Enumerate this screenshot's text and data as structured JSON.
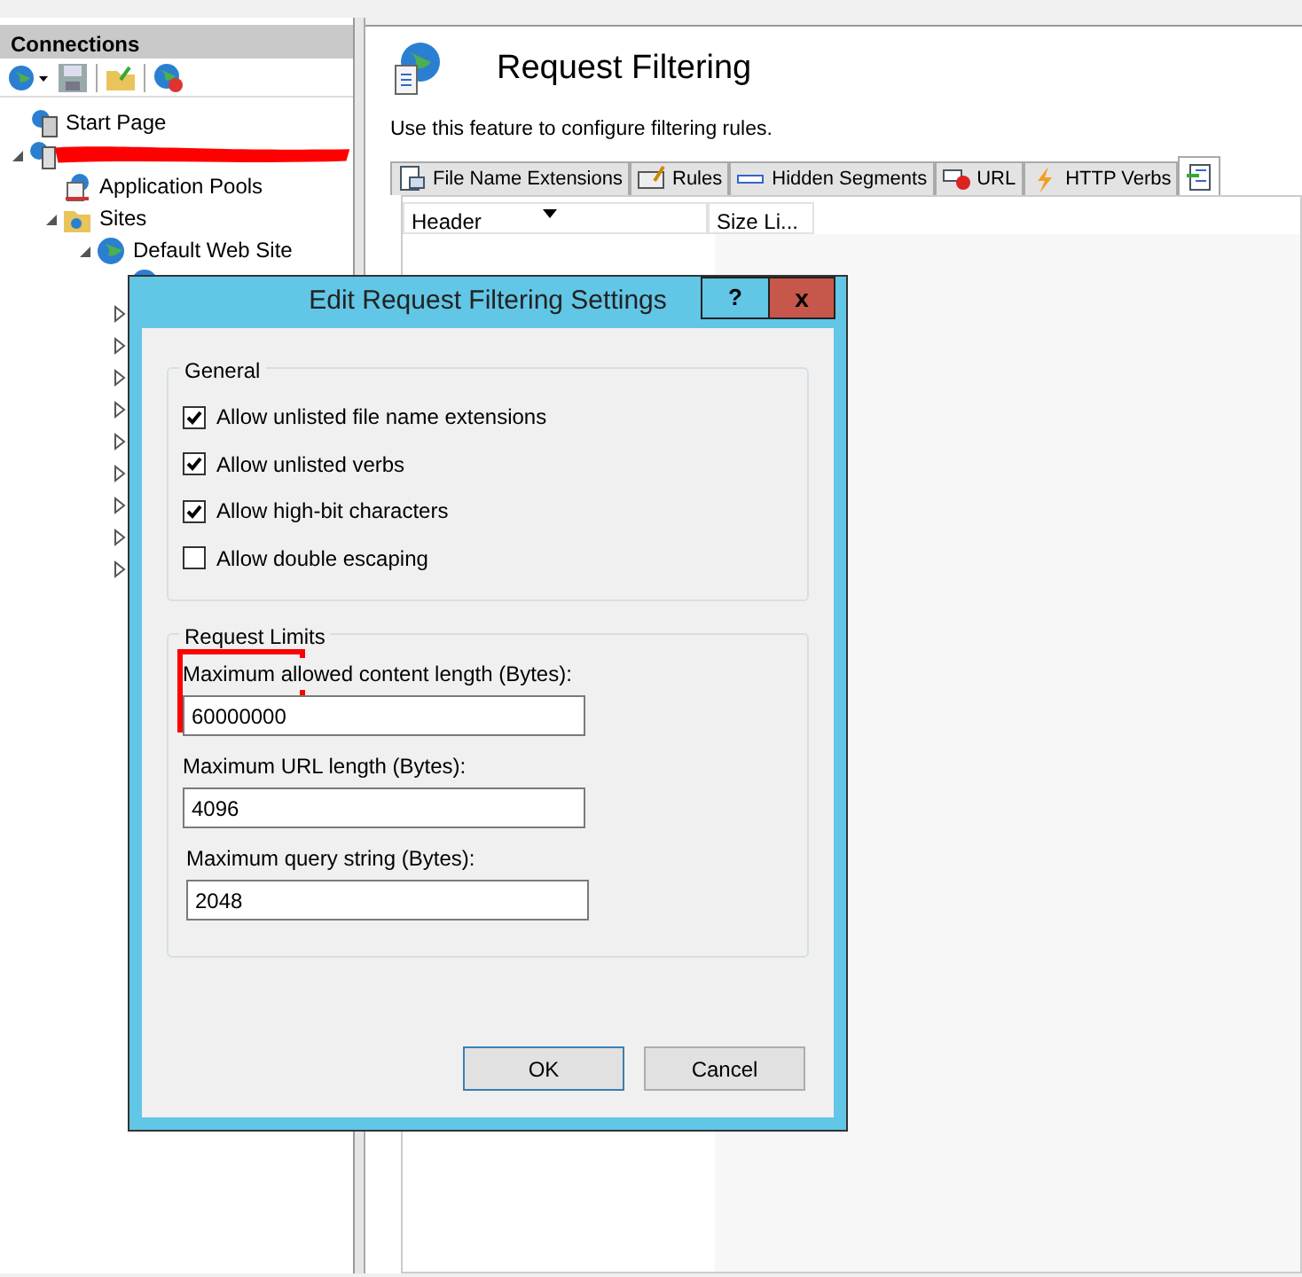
{
  "connections": {
    "title": "Connections",
    "tree": [
      {
        "kind": "page",
        "label": "Start Page"
      },
      {
        "kind": "server",
        "redacted": true,
        "expanded": true,
        "children": [
          {
            "kind": "pool",
            "label": "Application Pools"
          },
          {
            "kind": "folder",
            "label": "Sites",
            "expanded": true,
            "children": [
              {
                "kind": "site",
                "label": "Default Web Site",
                "expanded": true,
                "children": [
                  {
                    "kind": "site"
                  },
                  {
                    "expanded": false
                  },
                  {
                    "expanded": false
                  },
                  {
                    "expanded": false
                  },
                  {
                    "expanded": false
                  },
                  {
                    "expanded": false
                  },
                  {
                    "expanded": false
                  },
                  {
                    "expanded": false
                  },
                  {
                    "expanded": false
                  },
                  {
                    "expanded": false
                  }
                ]
              }
            ]
          }
        ]
      }
    ]
  },
  "feature": {
    "title": "Request Filtering",
    "description": "Use this feature to configure filtering rules.",
    "tabs": [
      {
        "kind": "ext",
        "label": "File Name Extensions",
        "selected": false
      },
      {
        "kind": "rules",
        "label": "Rules",
        "selected": false
      },
      {
        "kind": "segments",
        "label": "Hidden Segments",
        "selected": false
      },
      {
        "kind": "url",
        "label": "URL",
        "selected": false
      },
      {
        "kind": "verbs",
        "label": "HTTP Verbs",
        "selected": false
      },
      {
        "kind": "headers",
        "selected": true
      }
    ],
    "columns": [
      {
        "label": "Header",
        "sorted": true
      },
      {
        "label": "Size Li..."
      }
    ]
  },
  "dialog": {
    "title": "Edit Request Filtering Settings",
    "help": "?",
    "close": "x",
    "general": {
      "title": "General",
      "options": [
        {
          "label": "Allow unlisted file name extensions",
          "checked": true
        },
        {
          "label": "Allow unlisted verbs",
          "checked": true
        },
        {
          "label": "Allow high-bit characters",
          "checked": true
        },
        {
          "label": "Allow double escaping",
          "checked": false
        }
      ]
    },
    "limits": {
      "title": "Request Limits",
      "fields": [
        {
          "label": "Maximum allowed content length (Bytes):",
          "value": "60000000",
          "highlighted": true
        },
        {
          "label": "Maximum URL length (Bytes):",
          "value": "4096",
          "highlighted": false
        },
        {
          "label": "Maximum query string (Bytes):",
          "value": "2048",
          "highlighted": false
        }
      ]
    },
    "buttons": [
      {
        "label": "OK",
        "default": true
      },
      {
        "label": "Cancel",
        "default": false
      }
    ]
  }
}
